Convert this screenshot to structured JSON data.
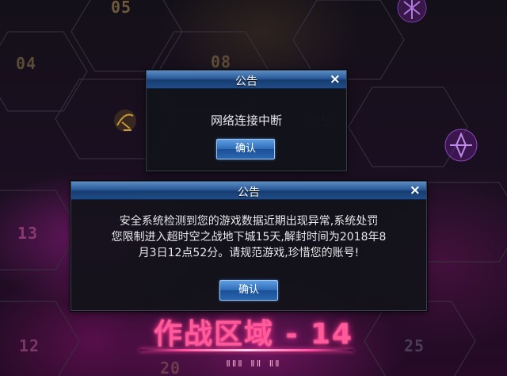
{
  "map": {
    "hex_numbers": [
      {
        "label": "05",
        "color": "#6e5a3a"
      },
      {
        "label": "04",
        "color": "#5a4c34"
      },
      {
        "label": "08",
        "color": "#5c4c36"
      },
      {
        "label": "09",
        "color": "#3a3032"
      },
      {
        "label": "13",
        "color": "#8a3a72"
      },
      {
        "label": "12",
        "color": "#7a3868"
      },
      {
        "label": "20",
        "color": "#6a3c4e"
      },
      {
        "label": "25",
        "color": "#4a3c58"
      }
    ],
    "zone_title": "作战区域 - 14",
    "zone_subtitle": "ⅡⅡⅡ ⅡⅡ ⅡⅡ"
  },
  "dialog_network": {
    "title": "公告",
    "close_label": "×",
    "message": "网络连接中断",
    "confirm_label": "确认"
  },
  "dialog_ban": {
    "title": "公告",
    "close_label": "×",
    "message_lines": [
      "安全系统检测到您的游戏数据近期出现异常,系统处罚",
      "您限制进入超时空之战地下城15天,解封时间为2018年8",
      "月3日12点52分。请规范游戏,珍惜您的账号!"
    ],
    "confirm_label": "确认"
  },
  "colors": {
    "title_bar": "#2a5a98",
    "zone_title": "#ff5a9a",
    "button": "#2e6cb8"
  }
}
